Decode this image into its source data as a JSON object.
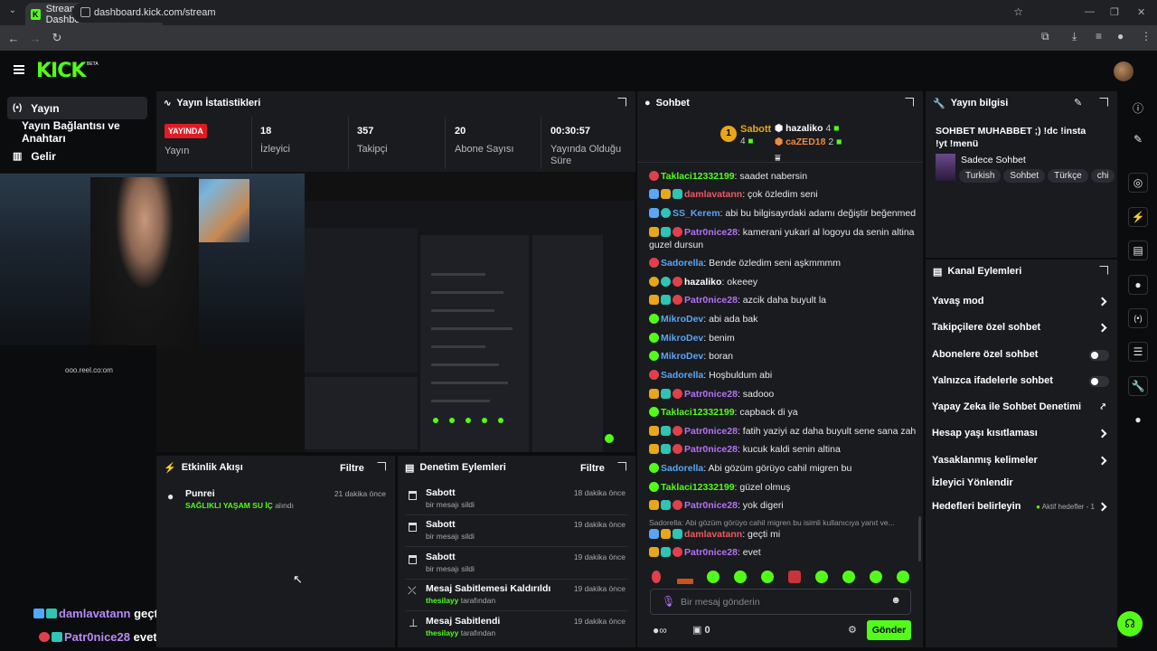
{
  "browser": {
    "tab_title": "Stream - Kick Dashboard",
    "url": "dashboard.kick.com/stream"
  },
  "header": {
    "logo": "KICK",
    "beta": "BETA"
  },
  "leftnav": {
    "items": [
      {
        "label": "Yayın",
        "icon": "broadcast-icon"
      },
      {
        "label": "Yayın Bağlantısı ve Anahtarı",
        "icon": ""
      },
      {
        "label": "Gelir",
        "icon": "chart-icon"
      }
    ]
  },
  "stats": {
    "title": "Yayın İstatistikleri",
    "live_badge": "YAYINDA",
    "live_label": "Yayın",
    "items": [
      {
        "value": "18",
        "label": "İzleyici"
      },
      {
        "value": "357",
        "label": "Takipçi"
      },
      {
        "value": "20",
        "label": "Abone Sayısı"
      },
      {
        "value": "00:30:57",
        "label": "Yayında Olduğu Süre"
      }
    ]
  },
  "overlay": {
    "watermark": "ooo.reel.co:om",
    "msg1_user": "damlavatann",
    "msg1_text": "geçti mi",
    "msg2_user": "Patr0nice28",
    "msg2_text": "evet"
  },
  "activity": {
    "title": "Etkinlik Akışı",
    "filter": "Filtre",
    "item_user": "Punrei",
    "item_reward": "SAĞLIKLI YAŞAM SU İÇ",
    "item_suffix": "alındı",
    "item_time": "21 dakika önce"
  },
  "moderation": {
    "title": "Denetim Eylemleri",
    "filter": "Filtre",
    "rows": [
      {
        "title": "Sabott",
        "sub": "bir mesajı sildi",
        "time": "18 dakika önce"
      },
      {
        "title": "Sabott",
        "sub": "bir mesajı sildi",
        "time": "19 dakika önce"
      },
      {
        "title": "Sabott",
        "sub": "bir mesajı sildi",
        "time": "19 dakika önce"
      },
      {
        "title": "Mesaj Sabitlemesi Kaldırıldı",
        "sub_user": "thesilayy",
        "sub": "tarafından",
        "time": "19 dakika önce"
      },
      {
        "title": "Mesaj Sabitlendi",
        "sub_user": "thesilayy",
        "sub": "tarafından",
        "time": "19 dakika önce"
      }
    ]
  },
  "chat": {
    "title": "Sohbet",
    "top": [
      {
        "name": "Sabott",
        "count": "4"
      },
      {
        "name": "hazaliko",
        "count": "4"
      },
      {
        "name": "caZED18",
        "count": "2"
      }
    ],
    "messages": [
      {
        "user": "Taklaci12332199",
        "text": ": saadet nabersin",
        "color": "green"
      },
      {
        "user": "damlavatann",
        "text": ": çok özledim seni",
        "color": "red"
      },
      {
        "user": "SS_Kerem",
        "text": ": abi bu bilgisayrdaki adamı değiştir beğenmedim",
        "color": "blue"
      },
      {
        "user": "Patr0nice28",
        "text": ": kamerani yukari al logoyu da senin altina al",
        "text2": "guzel dursun",
        "color": "purple"
      },
      {
        "user": "Sadorella",
        "text": ": Bende özledim seni aşkmmmm",
        "color": "blue"
      },
      {
        "user": "hazaliko",
        "text": ": okeeey",
        "color": "white"
      },
      {
        "user": "Patr0nice28",
        "text": ": azcik daha buyult la",
        "color": "purple"
      },
      {
        "user": "MikroDev",
        "text": ": abi ada bak",
        "color": "blue"
      },
      {
        "user": "MikroDev",
        "text": ": benim",
        "color": "blue"
      },
      {
        "user": "MikroDev",
        "text": ": boran",
        "color": "blue"
      },
      {
        "user": "Sadorella",
        "text": ": Hoşbuldum abi",
        "color": "blue"
      },
      {
        "user": "Patr0nice28",
        "text": ": sadooo",
        "color": "purple"
      },
      {
        "user": "Taklaci12332199",
        "text": ": capback di ya",
        "color": "green"
      },
      {
        "user": "Patr0nice28",
        "text": ": fatih yaziyi az daha buyult sene sana zahmet",
        "color": "purple"
      },
      {
        "user": "Patr0nice28",
        "text": ": kucuk kaldi senin altina",
        "color": "purple"
      },
      {
        "user": "Sadorella",
        "text": ": Abi gözüm görüyo cahil migren bu",
        "color": "blue"
      },
      {
        "user": "Taklaci12332199",
        "text": ": güzel olmuş",
        "color": "green"
      },
      {
        "user": "Patr0nice28",
        "text": ": yok digeri",
        "color": "purple"
      },
      {
        "user": "damlavatann",
        "text": ": geçti mi",
        "color": "red"
      },
      {
        "user": "Patr0nice28",
        "text": ": evet",
        "color": "purple"
      }
    ],
    "reply_preview": "Sadorella: Abi gözüm görüyo cahil migren bu isimli kullanıcıya yanıt ve...",
    "input_placeholder": "Bir mesaj gönderin",
    "points": "0",
    "send": "Gönder"
  },
  "stream_info": {
    "title": "Yayın bilgisi",
    "stream_title": "SOHBET MUHABBET ;) !dc !insta !yt !menü",
    "category": "Sadece Sohbet",
    "tags": [
      "Turkish",
      "Sohbet",
      "Türkçe",
      "chi"
    ]
  },
  "channel_actions": {
    "title": "Kanal Eylemleri",
    "items": [
      {
        "label": "Yavaş mod",
        "type": "chevron"
      },
      {
        "label": "Takipçilere özel sohbet",
        "type": "chevron"
      },
      {
        "label": "Abonelere özel sohbet",
        "type": "toggle"
      },
      {
        "label": "Yalnızca ifadelerle sohbet",
        "type": "toggle"
      },
      {
        "label": "Yapay Zeka ile Sohbet Denetimi",
        "type": "external"
      },
      {
        "label": "Hesap yaşı kısıtlaması",
        "type": "chevron"
      },
      {
        "label": "Yasaklanmış kelimeler",
        "type": "chevron"
      },
      {
        "label": "İzleyici Yönlendir",
        "type": "none"
      },
      {
        "label": "Hedefleri belirleyin",
        "type": "chevron",
        "extra": "Aktif hedefler - 1"
      }
    ]
  },
  "colors": {
    "brand": "#53fc18",
    "live": "#e01b24",
    "panel": "#191b1f"
  }
}
